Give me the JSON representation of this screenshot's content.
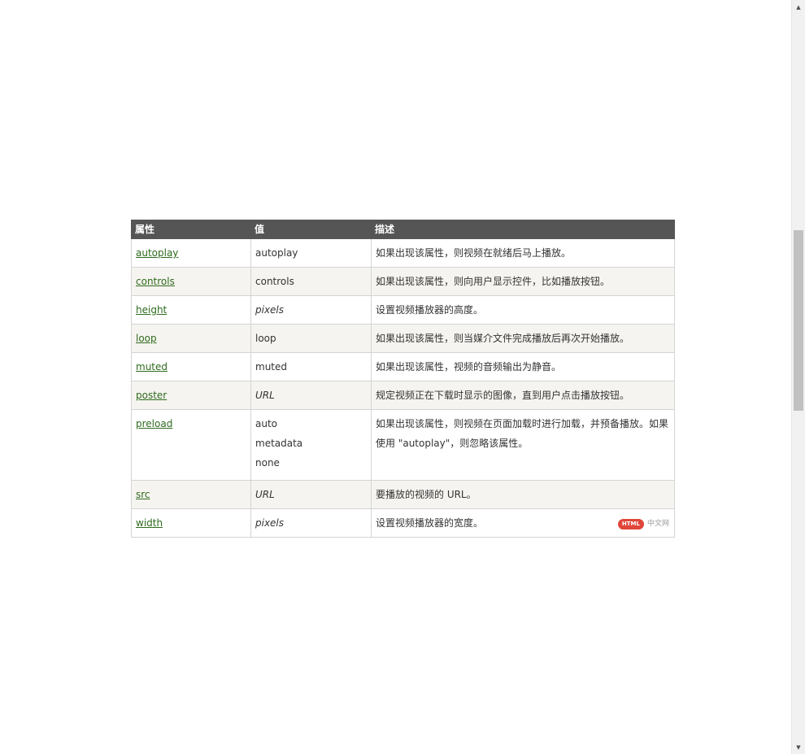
{
  "table": {
    "headers": [
      "属性",
      "值",
      "描述"
    ],
    "rows": [
      {
        "attr": "autoplay",
        "values": [
          "autoplay"
        ],
        "italic": false,
        "desc": "如果出现该属性，则视频在就绪后马上播放。"
      },
      {
        "attr": "controls",
        "values": [
          "controls"
        ],
        "italic": false,
        "desc": "如果出现该属性，则向用户显示控件，比如播放按钮。"
      },
      {
        "attr": "height",
        "values": [
          "pixels"
        ],
        "italic": true,
        "desc": "设置视频播放器的高度。"
      },
      {
        "attr": "loop",
        "values": [
          "loop"
        ],
        "italic": false,
        "desc": "如果出现该属性，则当媒介文件完成播放后再次开始播放。"
      },
      {
        "attr": "muted",
        "values": [
          "muted"
        ],
        "italic": false,
        "desc": "如果出现该属性，视频的音频输出为静音。"
      },
      {
        "attr": "poster",
        "values": [
          "URL"
        ],
        "italic": true,
        "desc": "规定视频正在下载时显示的图像，直到用户点击播放按钮。"
      },
      {
        "attr": "preload",
        "values": [
          "auto",
          "metadata",
          "none"
        ],
        "italic": false,
        "desc": "如果出现该属性，则视频在页面加载时进行加载，并预备播放。如果使用 \"autoplay\"，则忽略该属性。"
      },
      {
        "attr": "src",
        "values": [
          "URL"
        ],
        "italic": true,
        "desc": "要播放的视频的 URL。"
      },
      {
        "attr": "width",
        "values": [
          "pixels"
        ],
        "italic": true,
        "desc": "设置视频播放器的宽度。"
      }
    ]
  },
  "watermark": {
    "badge": "HTML",
    "text": "中文网"
  },
  "scrollbar": {
    "up_icon": "▲",
    "down_icon": "▼"
  }
}
